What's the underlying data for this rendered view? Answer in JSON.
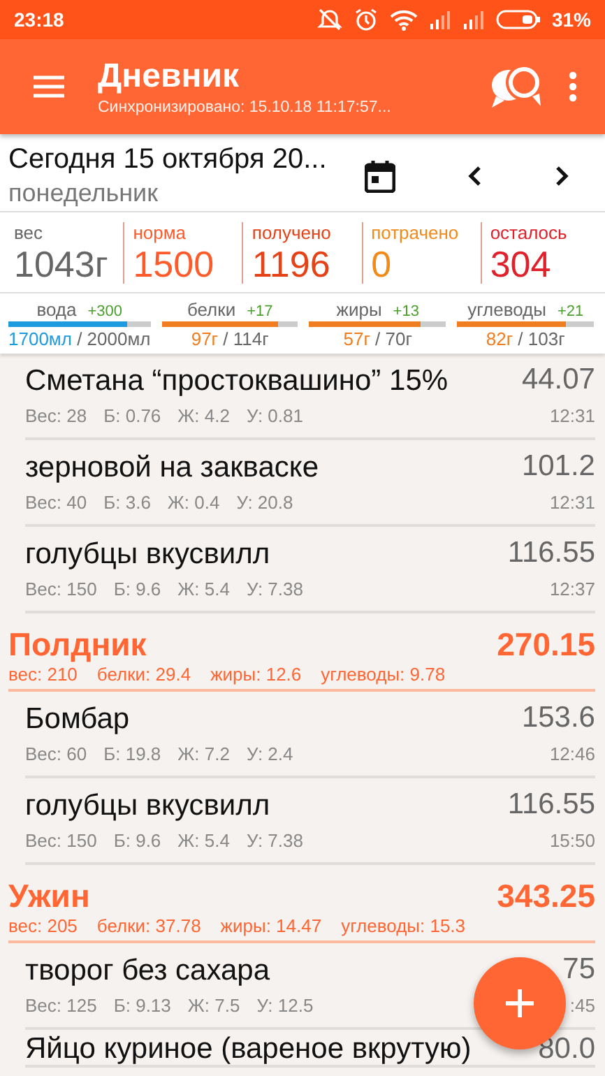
{
  "status_bar": {
    "time": "23:18",
    "battery": "31%"
  },
  "app_bar": {
    "title": "Дневник",
    "subtitle": "Синхронизировано: 15.10.18 11:17:57..."
  },
  "date": {
    "title": "Сегодня 15 октября 20...",
    "weekday": "понедельник"
  },
  "stats": [
    {
      "label": "вес",
      "value": "1043г",
      "color": "#666666"
    },
    {
      "label": "норма",
      "value": "1500",
      "color": "#ff5a2a"
    },
    {
      "label": "получено",
      "value": "1196",
      "color": "#e64217"
    },
    {
      "label": "потрачено",
      "value": "0",
      "color": "#f28a1a"
    },
    {
      "label": "осталось",
      "value": "304",
      "color": "#e0202a"
    }
  ],
  "macros": [
    {
      "label": "вода",
      "delta": "+300",
      "value": "1700мл",
      "target": " / 2000мл",
      "level": 0.84,
      "color": "#1e9be0"
    },
    {
      "label": "белки",
      "delta": "+17",
      "value": "97г",
      "target": " / 114г",
      "level": 0.85,
      "color": "#f07d20"
    },
    {
      "label": "жиры",
      "delta": "+13",
      "value": "57г",
      "target": " / 70г",
      "level": 0.81,
      "color": "#f07d20"
    },
    {
      "label": "углеводы",
      "delta": "+21",
      "value": "82г",
      "target": " / 103г",
      "level": 0.8,
      "color": "#f07d20"
    }
  ],
  "diary": [
    {
      "kind": "food",
      "name": "Сметана “простоквашино” 15%",
      "calories": "44.07",
      "meta": [
        "Вес: 28",
        "Б: 0.76",
        "Ж: 4.2",
        "У: 0.81"
      ],
      "time": "12:31"
    },
    {
      "kind": "food",
      "name": "зерновой на закваске",
      "calories": "101.2",
      "meta": [
        "Вес: 40",
        "Б: 3.6",
        "Ж: 0.4",
        "У: 20.8"
      ],
      "time": "12:31"
    },
    {
      "kind": "food",
      "name": "голубцы вкусвилл",
      "calories": "116.55",
      "meta": [
        "Вес: 150",
        "Б: 9.6",
        "Ж: 5.4",
        "У: 7.38"
      ],
      "time": "12:37"
    },
    {
      "kind": "meal",
      "name": "Полдник",
      "calories": "270.15",
      "meta": [
        "вес: 210",
        "белки: 29.4",
        "жиры: 12.6",
        "углеводы: 9.78"
      ]
    },
    {
      "kind": "food",
      "name": "Бомбар",
      "calories": "153.6",
      "meta": [
        "Вес: 60",
        "Б: 19.8",
        "Ж: 7.2",
        "У: 2.4"
      ],
      "time": "12:46"
    },
    {
      "kind": "food",
      "name": "голубцы вкусвилл",
      "calories": "116.55",
      "meta": [
        "Вес: 150",
        "Б: 9.6",
        "Ж: 5.4",
        "У: 7.38"
      ],
      "time": "15:50"
    },
    {
      "kind": "meal",
      "name": "Ужин",
      "calories": "343.25",
      "meta": [
        "вес: 205",
        "белки: 37.78",
        "жиры: 14.47",
        "углеводы: 15.3"
      ]
    },
    {
      "kind": "food",
      "name": "творог без сахара",
      "calories": "75",
      "meta": [
        "Вес: 125",
        "Б: 9.13",
        "Ж: 7.5",
        "У: 12.5"
      ],
      "time": ":45"
    },
    {
      "kind": "food",
      "name": "Яйцо куриное (вареное вкрутую)",
      "calories": "80.0"
    }
  ]
}
